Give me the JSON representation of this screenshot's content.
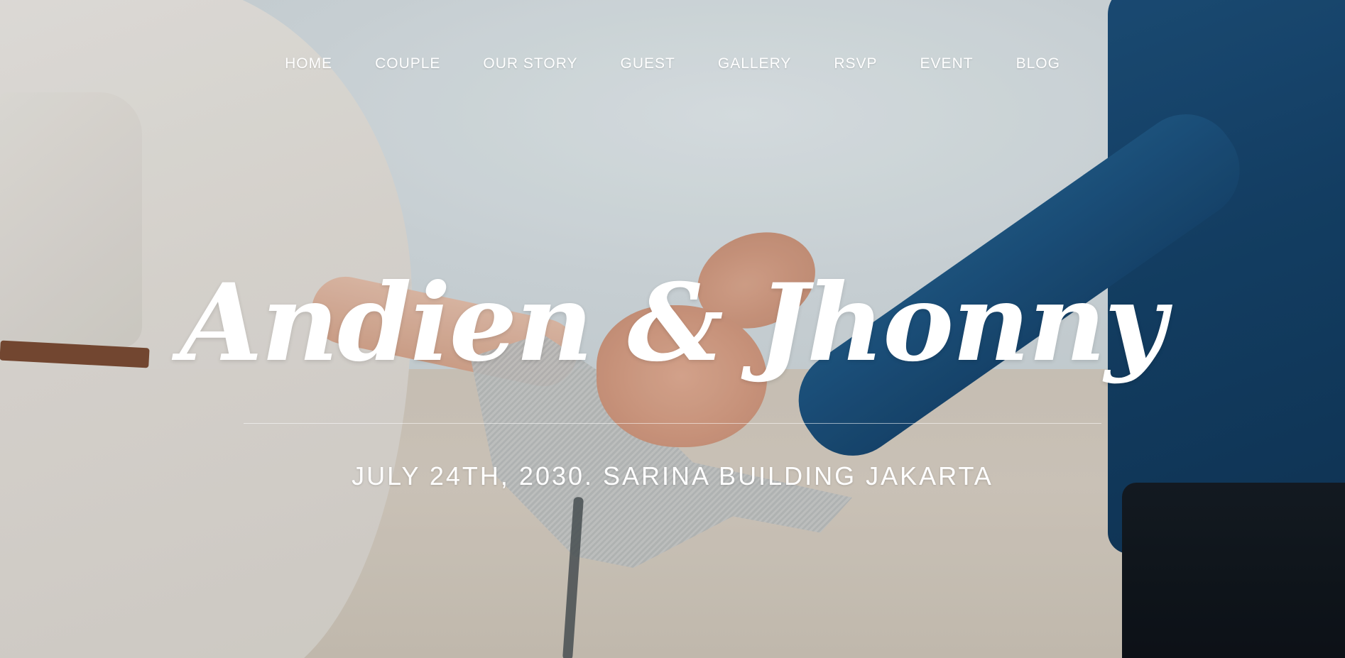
{
  "nav": {
    "items": [
      {
        "label": "HOME"
      },
      {
        "label": "COUPLE"
      },
      {
        "label": "OUR STORY"
      },
      {
        "label": "GUEST"
      },
      {
        "label": "GALLERY"
      },
      {
        "label": "RSVP"
      },
      {
        "label": "EVENT"
      },
      {
        "label": "BLOG"
      }
    ]
  },
  "hero": {
    "title": "Andien & Jhonny",
    "subtitle": "JULY 24TH, 2030. SARINA BUILDING JAKARTA"
  },
  "colors": {
    "text": "#ffffff",
    "shirt": "#123f66",
    "dress": "#e4e0da",
    "sky": "#d5dee2",
    "sand": "#d4ccc0"
  }
}
